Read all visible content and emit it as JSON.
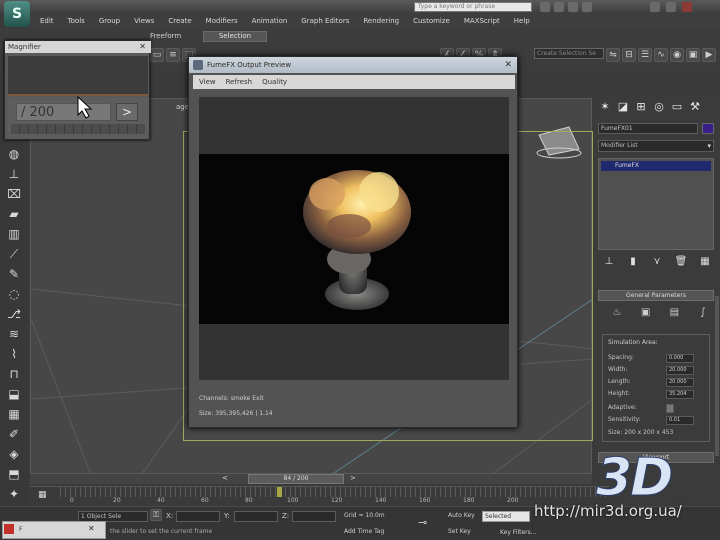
{
  "titlebar": {
    "title_text": "",
    "search_placeholder": "Type a keyword or phrase"
  },
  "menubar": {
    "items": [
      "Edit",
      "Tools",
      "Group",
      "Views",
      "Create",
      "Modifiers",
      "Animation",
      "Graph Editors",
      "Rendering",
      "Customize",
      "MAXScript",
      "Help"
    ]
  },
  "toolbar": {
    "freeform_tab": "Freeform",
    "selection_tab": "Selection",
    "selection_set": "Create Selection Se"
  },
  "magnifier": {
    "title": "Magnifier",
    "frame_count": "/ 200",
    "next_label": ">"
  },
  "viewport": {
    "label": "ages ]"
  },
  "preview": {
    "title": "FumeFX Output Preview",
    "menu": [
      "View",
      "Refresh",
      "Quality"
    ],
    "status_text": "Channels: smoke Exit",
    "size_text": "Size: 395,395,426 | 1.14"
  },
  "command_panel": {
    "object_name": "FumeFX01",
    "object_color": "#3a1f8a",
    "modifier_list": "Modifier List",
    "stack_item": "FumeFX",
    "general_parameters": "General Parameters",
    "simulation_area": "Simulation Area:",
    "params": [
      {
        "label": "Spacing:",
        "value": "0.000"
      },
      {
        "label": "Width:",
        "value": "20.000"
      },
      {
        "label": "Length:",
        "value": "20.000"
      },
      {
        "label": "Height:",
        "value": "35.204"
      },
      {
        "label": "Adaptive:",
        "value": ""
      },
      {
        "label": "Sensitivity:",
        "value": "0.01"
      }
    ],
    "sim_size": "Size: 200 x 200 x 453",
    "viewport_header": "Viewport"
  },
  "timeline": {
    "slider_text": "84 / 200",
    "tick_labels": [
      "0",
      "20",
      "40",
      "60",
      "80",
      "100",
      "120",
      "140",
      "160",
      "180",
      "200"
    ]
  },
  "statusbar": {
    "taskbar_label": "F",
    "object_selected": "1 Object Sele",
    "prompt": "the slider to set the current frame",
    "x_label": "X:",
    "y_label": "Y:",
    "z_label": "Z:",
    "grid": "Grid = 10.0m",
    "add_time_tag": "Add Time Tag",
    "auto_key": "Auto Key",
    "set_key": "Set Key",
    "selected": "Selected",
    "key_filters": "Key Filters..."
  },
  "watermark": {
    "logo": "3D",
    "url": "http://mir3d.org.ua/"
  }
}
